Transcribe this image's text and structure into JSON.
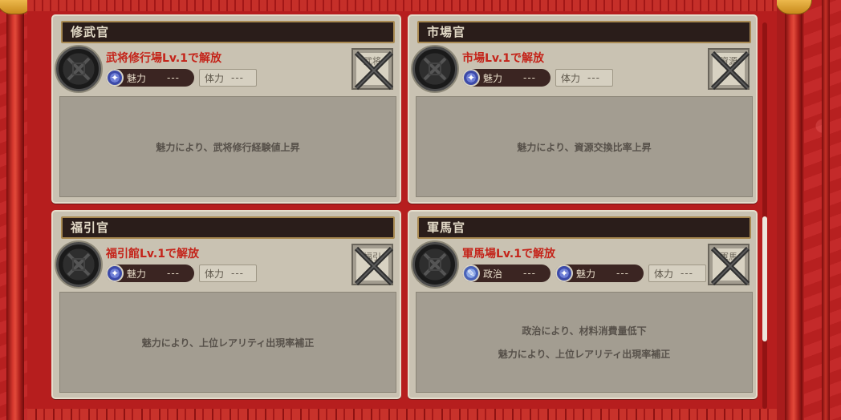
{
  "cards": [
    {
      "title": "修武官",
      "unlock": "武将修行場Lv.1で解放",
      "stats": [
        {
          "name": "魅力",
          "value": "---"
        }
      ],
      "stamina": {
        "name": "体力",
        "value": "---"
      },
      "icon_text": "武将",
      "descriptions": [
        "魅力により、武将修行経験値上昇"
      ]
    },
    {
      "title": "市場官",
      "unlock": "市場Lv.1で解放",
      "stats": [
        {
          "name": "魅力",
          "value": "---"
        }
      ],
      "stamina": {
        "name": "体力",
        "value": "---"
      },
      "icon_text": "資源",
      "descriptions": [
        "魅力により、資源交換比率上昇"
      ]
    },
    {
      "title": "福引官",
      "unlock": "福引館Lv.1で解放",
      "stats": [
        {
          "name": "魅力",
          "value": "---"
        }
      ],
      "stamina": {
        "name": "体力",
        "value": "---"
      },
      "icon_text": "福引",
      "descriptions": [
        "魅力により、上位レアリティ出現率補正"
      ]
    },
    {
      "title": "軍馬官",
      "unlock": "軍馬場Lv.1で解放",
      "stats": [
        {
          "name": "政治",
          "value": "---"
        },
        {
          "name": "魅力",
          "value": "---"
        }
      ],
      "stamina": {
        "name": "体力",
        "value": "---"
      },
      "icon_text": "軍馬",
      "descriptions": [
        "政治により、材料消費量低下",
        "魅力により、上位レアリティ出現率補正"
      ]
    }
  ],
  "icons": {
    "emblem": "locked-emblem-icon",
    "charm": "charm-stat-icon",
    "politics": "politics-stat-icon",
    "locked": "locked-cross-icon"
  },
  "colors": {
    "unlock_text": "#c4241a",
    "title_bar": "#2a1d1a",
    "frame_red": "#b61e1e"
  }
}
